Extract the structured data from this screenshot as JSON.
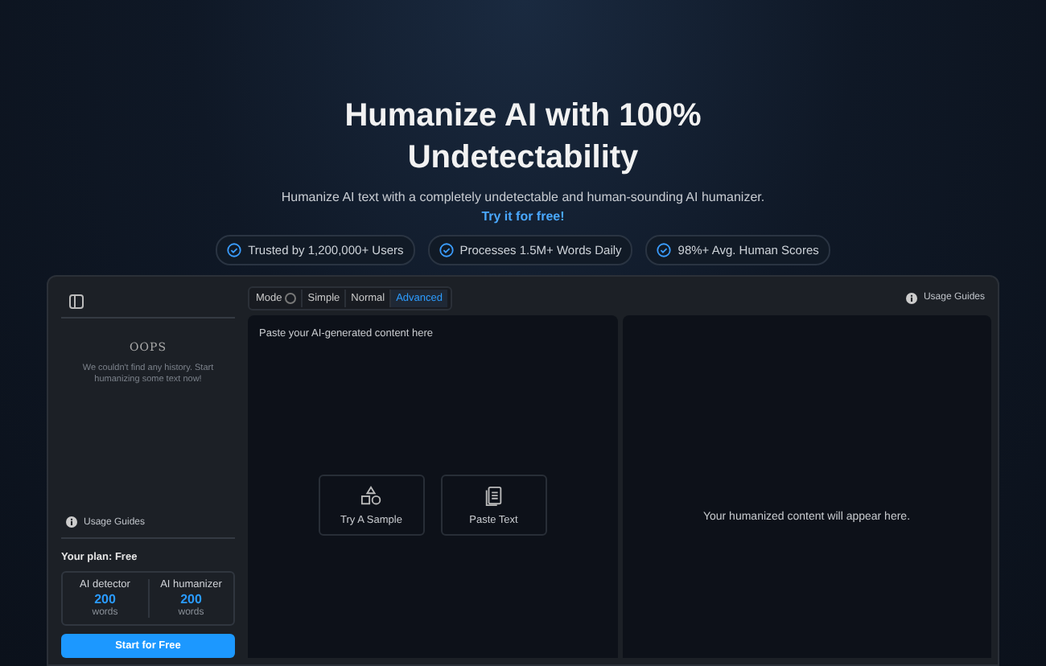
{
  "hero": {
    "title_lines": [
      "Humanize AI with 100%",
      "Undetectability"
    ],
    "subtitle": "Humanize AI text with a completely undetectable and human-sounding AI humanizer.",
    "link": "Try it for free!",
    "badges": [
      "Trusted by 1,200,000+ Users",
      "Processes 1.5M+ Words Daily",
      "98%+ Avg. Human Scores"
    ]
  },
  "sidebar": {
    "empty_title": "OOPS",
    "empty_message": "We couldn't find any history. Start humanizing some text now!",
    "usage_guides": "Usage Guides",
    "plan": "Your plan: Free",
    "stats": [
      {
        "label": "AI detector",
        "value": "200",
        "unit": "words"
      },
      {
        "label": "AI humanizer",
        "value": "200",
        "unit": "words"
      }
    ],
    "cta": "Start for Free"
  },
  "toolbar": {
    "mode_label": "Mode",
    "modes": [
      {
        "label": "Simple",
        "selected": false
      },
      {
        "label": "Normal",
        "selected": false
      },
      {
        "label": "Advanced",
        "selected": true
      }
    ],
    "usage_guides": "Usage Guides"
  },
  "input": {
    "placeholder": "Paste your AI-generated content here",
    "actions": [
      {
        "kind": "sample",
        "label": "Try A Sample"
      },
      {
        "kind": "paste",
        "label": "Paste Text"
      }
    ]
  },
  "output": {
    "placeholder": "Your humanized content will appear here."
  }
}
